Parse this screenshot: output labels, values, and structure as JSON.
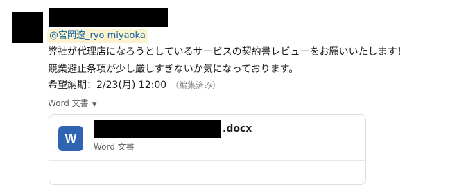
{
  "message": {
    "mention": "@宮岡遼_ryo miyaoka",
    "lines": [
      "弊社が代理店になろうとしているサービスの契約書レビューをお願いいたします！",
      "競業避止条項が少し厳しすぎないか気になっております。",
      "希望納期：2/23(月) 12:00"
    ],
    "edited_label": "（編集済み）"
  },
  "attachment": {
    "toggle_label": "Word 文書",
    "toggle_icon": "caret-down-icon",
    "file_icon_letter": "W",
    "file_extension": ".docx",
    "file_type": "Word 文書"
  },
  "colors": {
    "mention_bg": "#fdf3cf",
    "mention_text": "#1264a3",
    "word_icon_bg": "#2f64b3"
  }
}
